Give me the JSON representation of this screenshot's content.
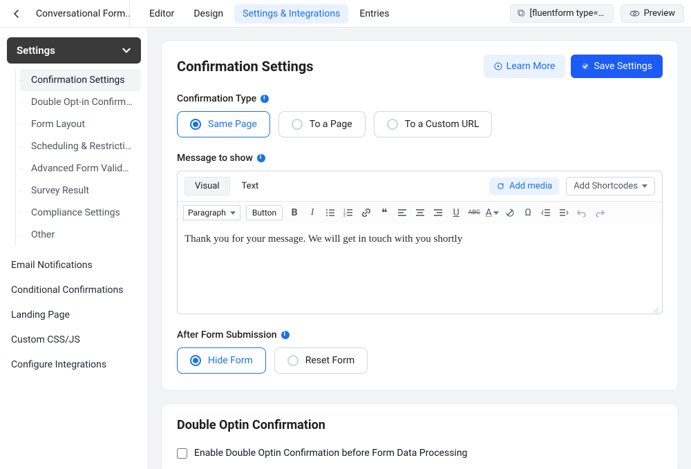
{
  "header": {
    "crumb": "Conversational Form...",
    "tabs": [
      "Editor",
      "Design",
      "Settings & Integrations",
      "Entries"
    ],
    "active_tab_index": 2,
    "shortcode_pill": "[fluentform type=\"c...",
    "preview_label": "Preview"
  },
  "sidebar": {
    "settings_header": "Settings",
    "subitems": [
      "Confirmation Settings",
      "Double Opt-in Confirma...",
      "Form Layout",
      "Scheduling & Restrictions",
      "Advanced Form Validati...",
      "Survey Result",
      "Compliance Settings",
      "Other"
    ],
    "active_subitem_index": 0,
    "links": [
      "Email Notifications",
      "Conditional Confirmations",
      "Landing Page",
      "Custom CSS/JS",
      "Configure Integrations"
    ]
  },
  "confirmation": {
    "title": "Confirmation Settings",
    "learn_more": "Learn More",
    "save": "Save Settings",
    "type_label": "Confirmation Type",
    "type_options": [
      "Same Page",
      "To a Page",
      "To a Custom URL"
    ],
    "type_selected_index": 0,
    "message_label": "Message to show",
    "editor": {
      "visual_tab": "Visual",
      "text_tab": "Text",
      "active_mode": "Visual",
      "add_media": "Add media",
      "add_shortcodes": "Add Shortcodes",
      "paragraph_label": "Paragraph",
      "button_label": "Button",
      "content": "Thank you for your message. We will get in touch with you shortly"
    },
    "after_label": "After Form Submission",
    "after_options": [
      "Hide Form",
      "Reset Form"
    ],
    "after_selected_index": 0
  },
  "double_optin": {
    "title": "Double Optin Confirmation",
    "checkbox_label": "Enable Double Optin Confirmation before Form Data Processing",
    "checked": false
  },
  "icons": {
    "toolbar": [
      "B",
      "I",
      "≔",
      "☰",
      "🔗",
      "❝",
      "≡",
      "≡",
      "≡",
      "U",
      "ᴀʙᴄ",
      "A",
      "🧹",
      "Ω",
      "↤",
      "↦",
      "↶",
      "↷"
    ]
  }
}
